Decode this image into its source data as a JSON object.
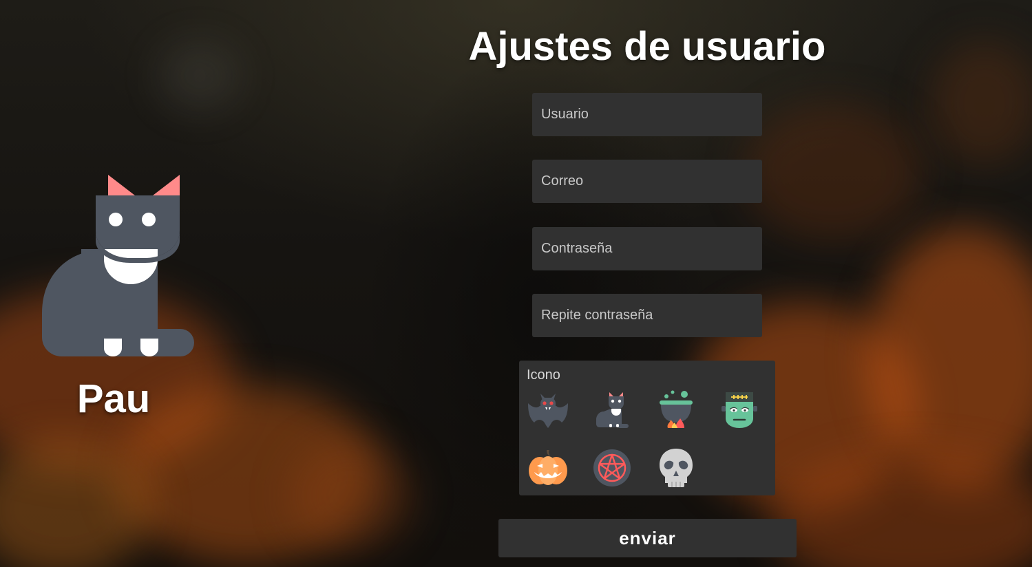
{
  "profile": {
    "name": "Pau",
    "avatar_icon": "cat-icon"
  },
  "page": {
    "title": "Ajustes de usuario"
  },
  "form": {
    "username": {
      "placeholder": "Usuario",
      "value": ""
    },
    "email": {
      "placeholder": "Correo",
      "value": ""
    },
    "password": {
      "placeholder": "Contraseña",
      "value": ""
    },
    "password_repeat": {
      "placeholder": "Repite contraseña",
      "value": ""
    },
    "icon_picker": {
      "label": "Icono",
      "options": [
        "bat-icon",
        "cat-icon",
        "cauldron-icon",
        "frankenstein-icon",
        "pumpkin-icon",
        "pentagram-icon",
        "skull-icon"
      ]
    },
    "submit_label": "enviar"
  },
  "colors": {
    "field_background": "#313131",
    "text": "#ffffff",
    "cat_body": "#4f5661",
    "cat_ears": "#ff8a8a",
    "pumpkin": "#ff9a4d",
    "frankenstein": "#67c39a"
  }
}
